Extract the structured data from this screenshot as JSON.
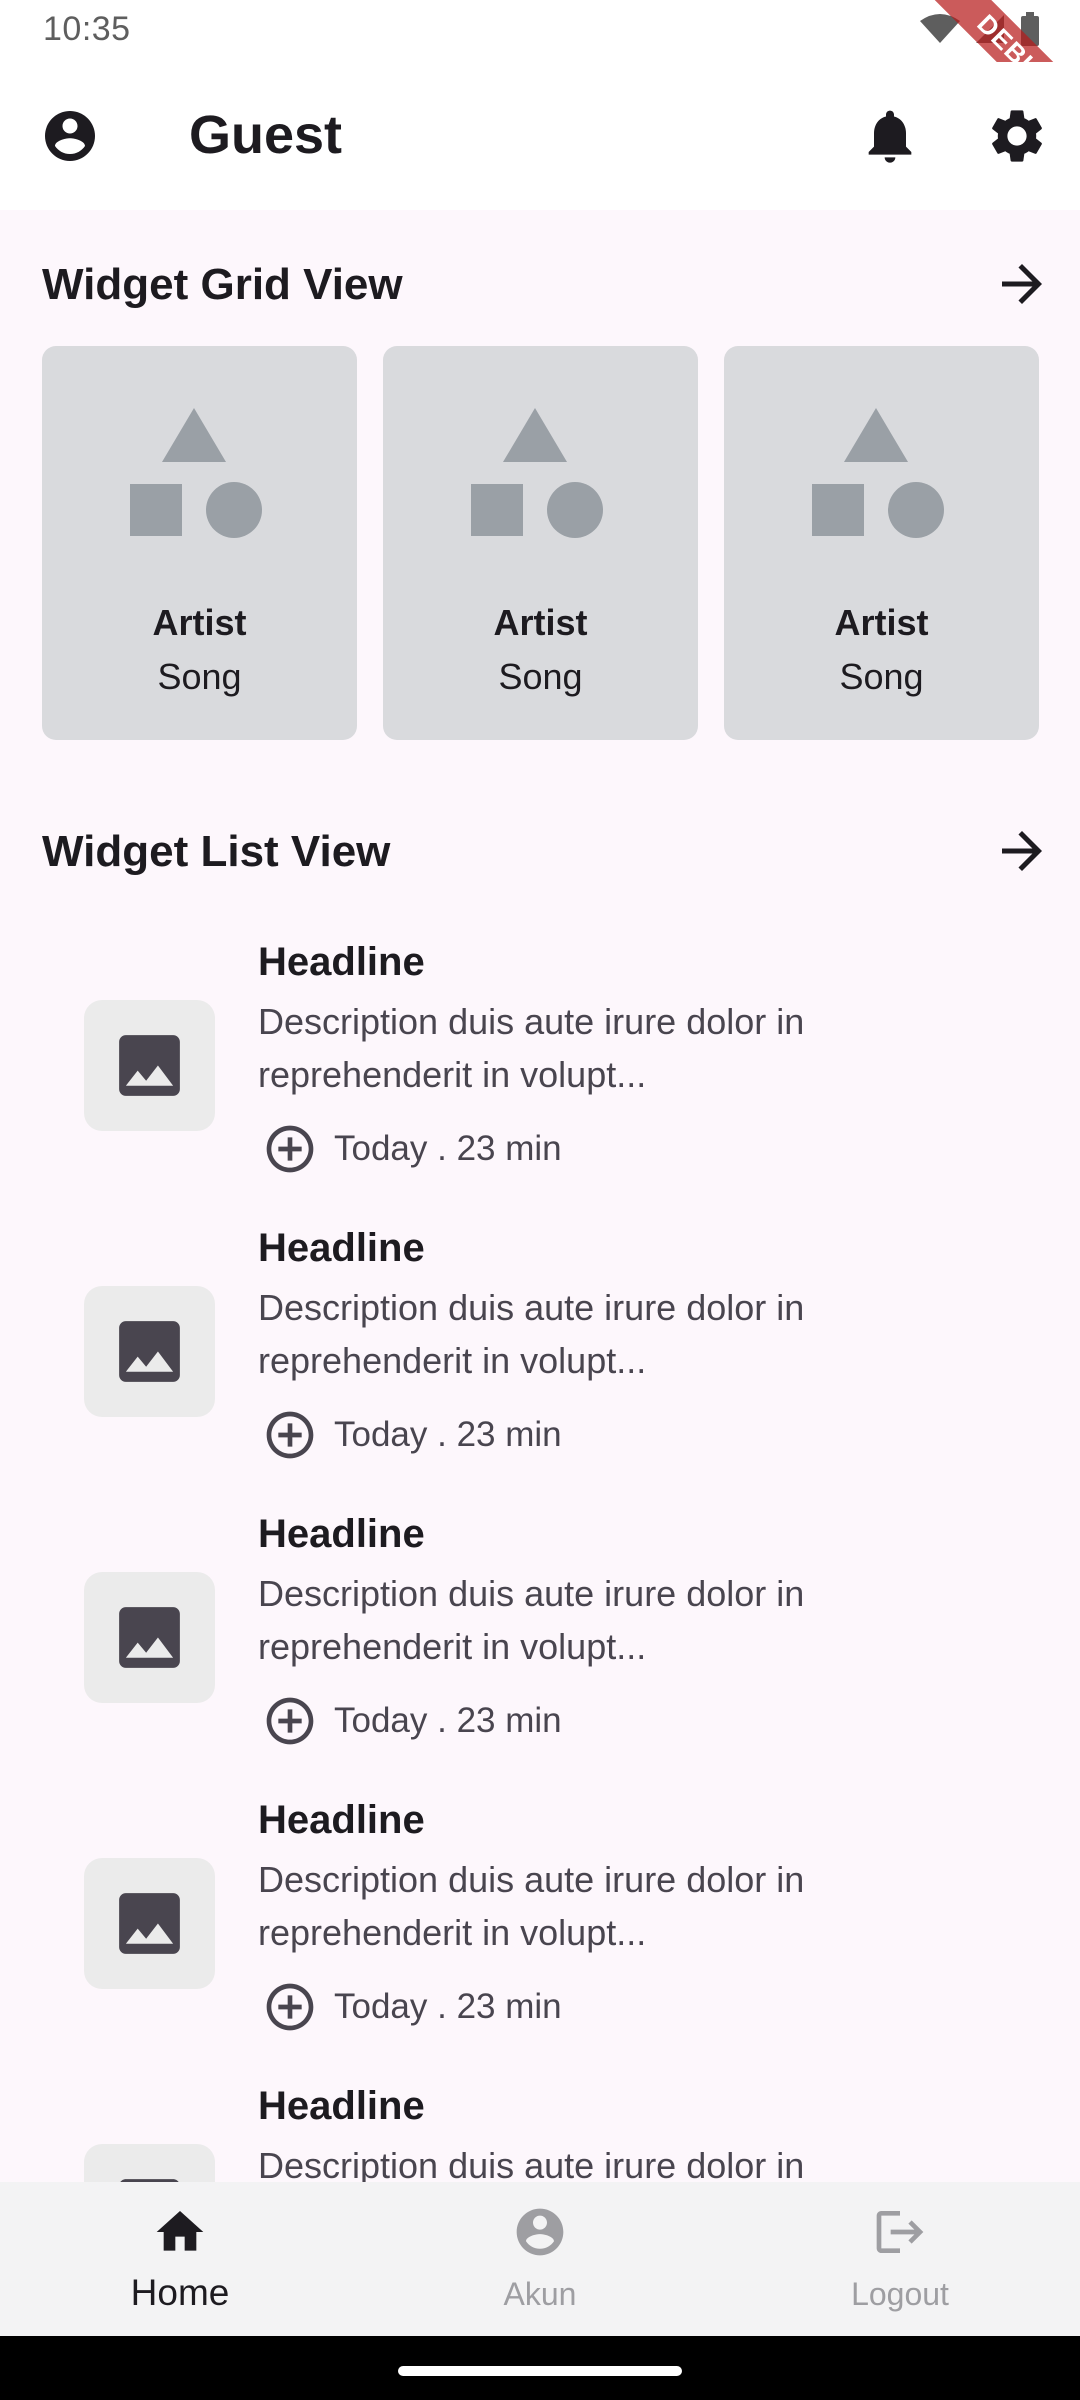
{
  "status_bar": {
    "time": "10:35",
    "debug_label": "DEBUG"
  },
  "app_bar": {
    "title": "Guest"
  },
  "grid_section": {
    "title": "Widget Grid View",
    "cards": [
      {
        "artist": "Artist",
        "song": "Song"
      },
      {
        "artist": "Artist",
        "song": "Song"
      },
      {
        "artist": "Artist",
        "song": "Song"
      }
    ]
  },
  "list_section": {
    "title": "Widget List View",
    "items": [
      {
        "headline": "Headline",
        "description": "Description duis aute irure dolor in reprehenderit in volupt...",
        "meta": "Today . 23 min"
      },
      {
        "headline": "Headline",
        "description": "Description duis aute irure dolor in reprehenderit in volupt...",
        "meta": "Today . 23 min"
      },
      {
        "headline": "Headline",
        "description": "Description duis aute irure dolor in reprehenderit in volupt...",
        "meta": "Today . 23 min"
      },
      {
        "headline": "Headline",
        "description": "Description duis aute irure dolor in reprehenderit in volupt...",
        "meta": "Today . 23 min"
      },
      {
        "headline": "Headline",
        "description": "Description duis aute irure dolor in",
        "meta": ""
      }
    ]
  },
  "bottom_nav": {
    "items": [
      {
        "label": "Home",
        "icon": "home-icon",
        "active": true
      },
      {
        "label": "Akun",
        "icon": "account-icon",
        "active": false
      },
      {
        "label": "Logout",
        "icon": "logout-icon",
        "active": false
      }
    ]
  },
  "colors": {
    "background": "#fdf7fc",
    "card": "#d9dadd",
    "thumb": "#ebebeb",
    "nav_bar": "#f3f3f4",
    "debug_ribbon": "#b71c1c"
  }
}
